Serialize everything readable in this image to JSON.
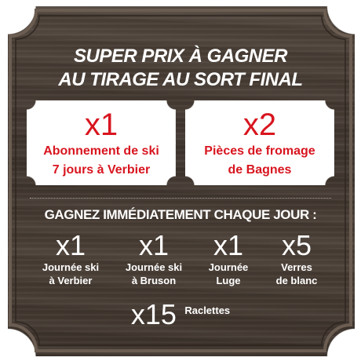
{
  "header": {
    "line1": "SUPER PRIX À GAGNER",
    "line2": "AU TIRAGE AU SORT FINAL"
  },
  "grand_prizes": [
    {
      "qty": "x1",
      "line1": "Abonnement de ski",
      "line2": "7 jours à Verbier"
    },
    {
      "qty": "x2",
      "line1": "Pièces de fromage",
      "line2": "de Bagnes"
    }
  ],
  "daily_title": "GAGNEZ IMMÉDIATEMENT CHAQUE JOUR :",
  "daily_prizes": [
    {
      "qty": "x1",
      "line1": "Journée ski",
      "line2": "à Verbier"
    },
    {
      "qty": "x1",
      "line1": "Journée ski",
      "line2": "à Bruson"
    },
    {
      "qty": "x1",
      "line1": "Journée",
      "line2": "Luge"
    },
    {
      "qty": "x5",
      "line1": "Verres",
      "line2": "de blanc"
    }
  ],
  "extra_prize": {
    "qty": "x15",
    "label": "Raclettes"
  },
  "colors": {
    "accent_red": "#d8151f",
    "wood": "#46392f",
    "frame": "#5a4d42"
  }
}
